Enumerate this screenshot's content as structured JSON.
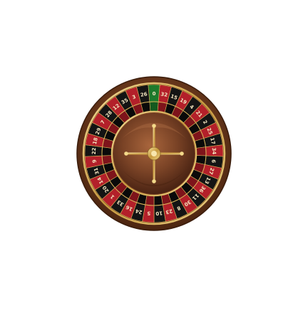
{
  "game": {
    "type": "european-roulette",
    "wheel_numbers": [
      0,
      32,
      15,
      19,
      4,
      21,
      2,
      25,
      17,
      34,
      6,
      27,
      13,
      36,
      11,
      30,
      8,
      23,
      10,
      5,
      24,
      16,
      33,
      1,
      20,
      14,
      31,
      9,
      22,
      18,
      29,
      7,
      28,
      12,
      35,
      3,
      26
    ],
    "colors": {
      "red": "#b3202a",
      "black": "#141414",
      "green": "#1e7a2c",
      "gold": "#d9b45a",
      "wood": "#6b3a1c",
      "bowl": "#7a4326",
      "number_text": "#f5e6c0"
    }
  }
}
